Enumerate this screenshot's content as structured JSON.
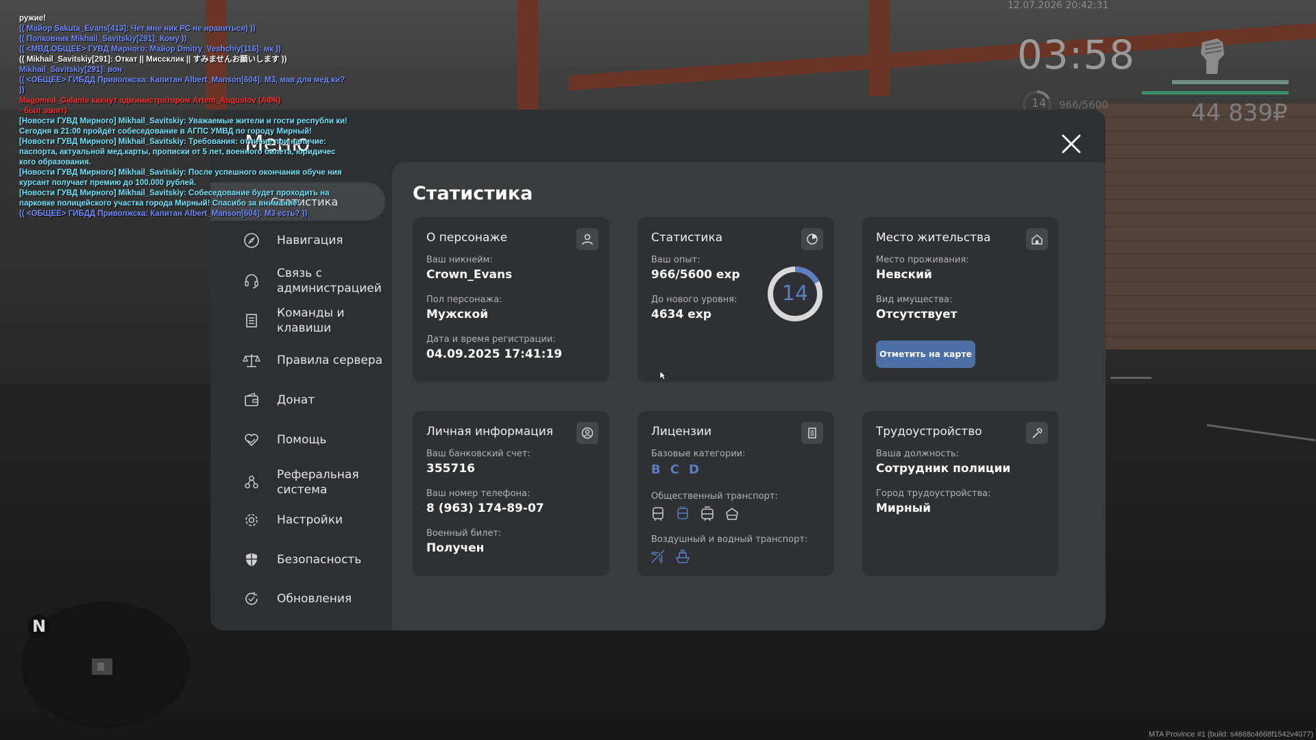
{
  "hud": {
    "datetime": "12.07.2026 20:42:31",
    "time": "03:58",
    "level": "14",
    "exp": "966/5600",
    "money": "44 839₽"
  },
  "chat": [
    {
      "text": "ружие!",
      "color": "#ffffff"
    },
    {
      "text": "(( Майор Sakuta_Evans[413]: Чет мне ник РС не нравиться) ))",
      "color": "#6f8cff"
    },
    {
      "text": "(( Полковник Mikhail_Savitskiy[291]: Кому ))",
      "color": "#6f8cff"
    },
    {
      "text": "(( <МВД.ОБЩЕЕ> ГУВД Мирного: Майор Dmitry_Veshchiy[116]: мк ))",
      "color": "#6f8cff"
    },
    {
      "text": "(( Mikhail_Savitskiy[291]: Откат || Миссклик || すみませんお願いします ))",
      "color": "#ffffff"
    },
    {
      "text": "Mikhail_Savitskiy[291]: вон",
      "color": "#6f8cff"
    },
    {
      "text": "(( <ОБЩЕЕ> ГИБДД Приволжска: Капитан Albert_Manson[604]: М3, мав для мед ки? ))",
      "color": "#6f8cff"
    },
    {
      "text": "Magomed_Galante кикнут администратором Artem_Augustov (АФК)",
      "color": "#ff2a2a"
    },
    {
      "text": "- был занят)",
      "color": "#ff2a2a"
    },
    {
      "text": "[Новости ГУВД Мирного] Mikhail_Savitskiy: Уважаемые жители и гости республи ки! Сегодня в 21:00 пройдёт собеседование в АГПС УМВД по городу Мирный!",
      "color": "#6fe8ff"
    },
    {
      "text": "[Новости ГУВД Мирного] Mikhail_Savitskiy: Требования: отличие при наличие: паспорта, актуальной мед.карты, прописки от 5 лет, военного билета, юридичес кого образования.",
      "color": "#6fe8ff"
    },
    {
      "text": "[Новости ГУВД Мирного] Mikhail_Savitskiy: После успешного окончания обуче ния курсант получает премию до 100.000 рублей.",
      "color": "#6fe8ff"
    },
    {
      "text": "[Новости ГУВД Мирного] Mikhail_Savitskiy: Собеседование будет проходить на парковке полицейского участка города Мирный! Спасибо за внимание!",
      "color": "#6fe8ff"
    },
    {
      "text": "(( <ОБЩЕЕ> ГИБДД Приволжска: Капитан Albert_Manson[604]: М3 есть? ))",
      "color": "#6f8cff"
    }
  ],
  "menu": {
    "title": "Меню",
    "active_item": "Статистика",
    "nav": [
      {
        "label": "Навигация",
        "icon": "compass-icon"
      },
      {
        "label": "Связь с администрацией",
        "icon": "headset-icon"
      },
      {
        "label": "Команды и клавиши",
        "icon": "document-icon"
      },
      {
        "label": "Правила сервера",
        "icon": "scales-icon"
      },
      {
        "label": "Донат",
        "icon": "wallet-icon"
      },
      {
        "label": "Помощь",
        "icon": "heart-hand-icon"
      },
      {
        "label": "Реферальная система",
        "icon": "referral-icon"
      },
      {
        "label": "Настройки",
        "icon": "gear-icon"
      },
      {
        "label": "Безопасность",
        "icon": "shield-icon"
      },
      {
        "label": "Обновления",
        "icon": "refresh-icon"
      }
    ]
  },
  "section_title": "Статистика",
  "cards": {
    "character": {
      "title": "О персонаже",
      "nick_label": "Ваш никнейм:",
      "nick": "Crown_Evans",
      "gender_label": "Пол персонажа:",
      "gender": "Мужской",
      "reg_label": "Дата и время регистрации:",
      "reg": "04.09.2025 17:41:19"
    },
    "stats": {
      "title": "Статистика",
      "exp_label": "Ваш опыт:",
      "exp": "966/5600 exp",
      "next_label": "До нового уровня:",
      "next": "4634 exp",
      "level": "14",
      "progress": 0.1725
    },
    "residence": {
      "title": "Место жительства",
      "place_label": "Место проживания:",
      "place": "Невский",
      "property_label": "Вид имущества:",
      "property": "Отсутствует",
      "button": "Отметить на карте"
    },
    "personal": {
      "title": "Личная информация",
      "bank_label": "Ваш банковский счет:",
      "bank": "355716",
      "phone_label": "Ваш номер телефона:",
      "phone": "8 (963) 174-89-07",
      "military_label": "Военный билет:",
      "military": "Получен"
    },
    "licenses": {
      "title": "Лицензии",
      "base_label": "Базовые категории:",
      "base": [
        "B",
        "C",
        "D"
      ],
      "public_label": "Общественный транспорт:",
      "public_icons": [
        "bus-icon",
        "trolleybus-icon",
        "tram-icon",
        "metro-icon"
      ],
      "air_label": "Воздушный и водный транспорт:",
      "air_icons": [
        "plane-icon",
        "boat-icon"
      ]
    },
    "job": {
      "title": "Трудоустройство",
      "position_label": "Ваша должность:",
      "position": "Сотрудник полиции",
      "city_label": "Город трудоустройства:",
      "city": "Мирный"
    }
  },
  "minimap_label": "N",
  "build": "MTA Province #1 (build: s4668c4668f1542v4077)",
  "colors": {
    "accent": "#5b7fc0",
    "button": "#4c6fa6",
    "panel": "#2e2f31",
    "content": "#3a3b3e",
    "card": "#2f3033"
  }
}
